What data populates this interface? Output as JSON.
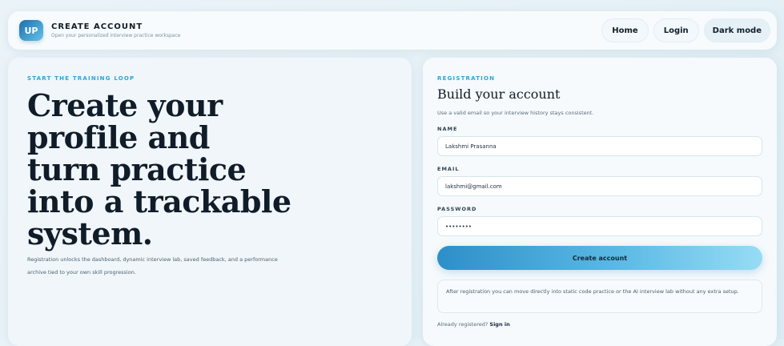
{
  "header": {
    "logo_text": "UP",
    "title": "CREATE ACCOUNT",
    "subtitle": "Open your personalized interview practice workspace",
    "nav": {
      "home": "Home",
      "login": "Login",
      "dark_mode": "Dark mode"
    }
  },
  "hero": {
    "eyebrow": "START THE TRAINING LOOP",
    "heading": "Create your profile and turn practice into a trackable system.",
    "description": "Registration unlocks the dashboard, dynamic interview lab, saved feedback, and a performance archive tied to your own skill progression."
  },
  "form": {
    "eyebrow": "REGISTRATION",
    "title": "Build your account",
    "subtitle": "Use a valid email so your interview history stays consistent.",
    "name_label": "NAME",
    "name_value": "Lakshmi Prasanna",
    "email_label": "EMAIL",
    "email_value": "lakshmi@gmail.com",
    "password_label": "PASSWORD",
    "password_value": "••••••••",
    "submit_label": "Create account",
    "note": "After registration you can move directly into static code practice or the AI interview lab without any extra setup.",
    "signin_prompt": "Already registered?",
    "signin_link": "Sign in"
  },
  "colors": {
    "accent": "#2aa6d6",
    "button_start": "#2d8fc8",
    "button_end": "#97dcf5",
    "text_dark": "#101c28"
  }
}
